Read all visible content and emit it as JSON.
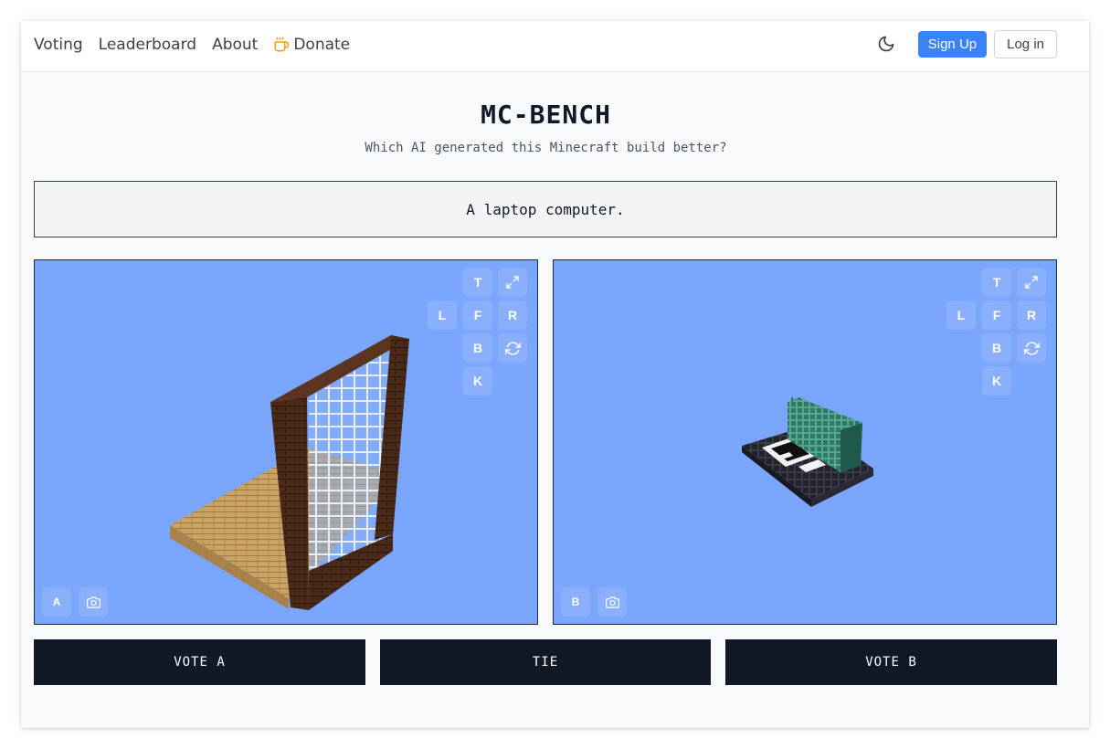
{
  "nav": {
    "links": [
      {
        "label": "Voting"
      },
      {
        "label": "Leaderboard"
      },
      {
        "label": "About"
      },
      {
        "label": "Donate",
        "icon": "coffee-icon"
      }
    ],
    "theme_icon": "moon-icon",
    "signup_label": "Sign Up",
    "login_label": "Log in"
  },
  "header": {
    "title": "MC-BENCH",
    "subtitle": "Which AI generated this Minecraft build better?"
  },
  "prompt": "A laptop computer.",
  "viewers": [
    {
      "model_label": "A",
      "controls": {
        "top": "T",
        "left": "L",
        "front": "F",
        "right": "R",
        "back": "B",
        "k": "K"
      },
      "icons": [
        "expand-icon",
        "rotate-icon",
        "camera-icon"
      ]
    },
    {
      "model_label": "B",
      "controls": {
        "top": "T",
        "left": "L",
        "front": "F",
        "right": "R",
        "back": "B",
        "k": "K"
      },
      "icons": [
        "expand-icon",
        "rotate-icon",
        "camera-icon"
      ]
    }
  ],
  "votes": {
    "a_label": "VOTE A",
    "tie_label": "TIE",
    "b_label": "VOTE B"
  },
  "colors": {
    "accent": "#3b82f6",
    "viewer_bg": "#7aa6fd",
    "vote_bg": "#111827",
    "donate_icon": "#f59e0b"
  }
}
